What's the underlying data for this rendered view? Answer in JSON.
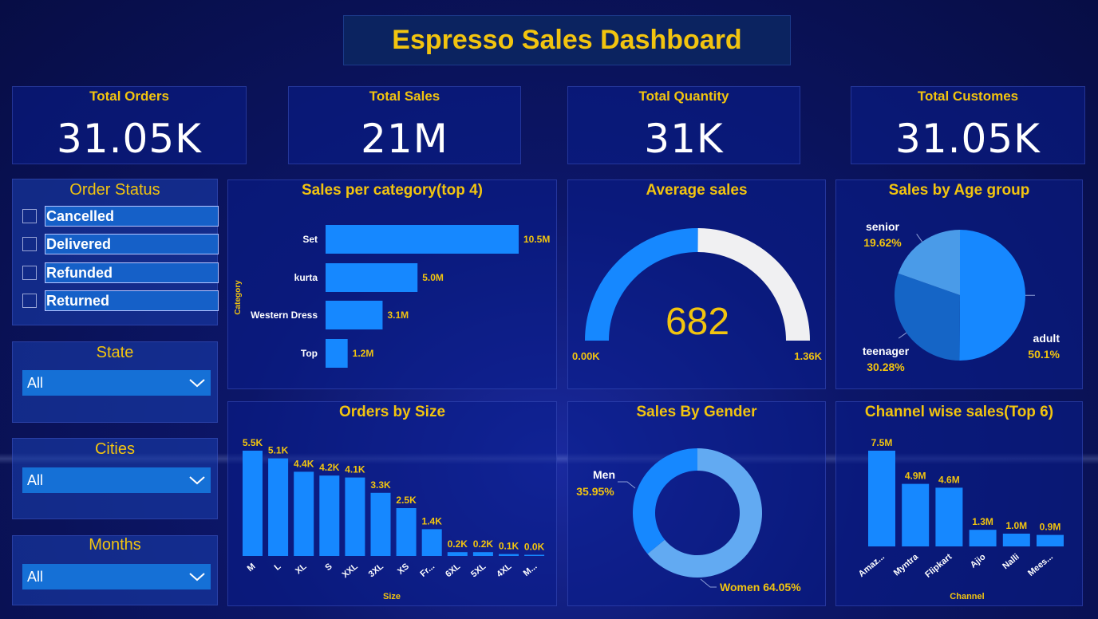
{
  "title": "Espresso Sales Dashboard",
  "kpis": [
    {
      "label": "Total Orders",
      "value": "31.05K"
    },
    {
      "label": "Total Sales",
      "value": "21M"
    },
    {
      "label": "Total Quantity",
      "value": "31K"
    },
    {
      "label": "Total Customes",
      "value": "31.05K"
    }
  ],
  "filters": {
    "order_status": {
      "title": "Order Status",
      "options": [
        "Cancelled",
        "Delivered",
        "Refunded",
        "Returned"
      ]
    },
    "state": {
      "title": "State",
      "value": "All"
    },
    "cities": {
      "title": "Cities",
      "value": "All"
    },
    "months": {
      "title": "Months",
      "value": "All"
    }
  },
  "chart_data": [
    {
      "type": "bar",
      "orientation": "horizontal",
      "title": "Sales per category(top 4)",
      "ylabel": "Category",
      "categories": [
        "Set",
        "kurta",
        "Western Dress",
        "Top"
      ],
      "values": [
        10.5,
        5.0,
        3.1,
        1.2
      ],
      "labels": [
        "10.5M",
        "5.0M",
        "3.1M",
        "1.2M"
      ],
      "color": "#1688ff"
    },
    {
      "type": "gauge",
      "title": "Average sales",
      "value": 682,
      "value_label": "682",
      "min": 0,
      "max": 1360,
      "min_label": "0.00K",
      "max_label": "1.36K",
      "colors": {
        "fill": "#1688ff",
        "rest": "#f0f0f2",
        "value": "#f2c40f"
      }
    },
    {
      "type": "pie",
      "title": "Sales by Age group",
      "slices": [
        {
          "name": "adult",
          "value": 50.1,
          "label": "50.1%",
          "color": "#1688ff"
        },
        {
          "name": "teenager",
          "value": 30.28,
          "label": "30.28%",
          "color": "#1565c6"
        },
        {
          "name": "senior",
          "value": 19.62,
          "label": "19.62%",
          "color": "#4a9be8"
        }
      ]
    },
    {
      "type": "bar",
      "title": "Orders by Size",
      "xlabel": "Size",
      "categories": [
        "M",
        "L",
        "XL",
        "S",
        "XXL",
        "3XL",
        "XS",
        "Fr...",
        "6XL",
        "5XL",
        "4XL",
        "M..."
      ],
      "values": [
        5.5,
        5.1,
        4.4,
        4.2,
        4.1,
        3.3,
        2.5,
        1.4,
        0.2,
        0.2,
        0.1,
        0.0
      ],
      "labels": [
        "5.5K",
        "5.1K",
        "4.4K",
        "4.2K",
        "4.1K",
        "3.3K",
        "2.5K",
        "1.4K",
        "0.2K",
        "0.2K",
        "0.1K",
        "0.0K"
      ],
      "color": "#1688ff"
    },
    {
      "type": "donut",
      "title": "Sales By Gender",
      "slices": [
        {
          "name": "Women",
          "value": 64.05,
          "label": "64.05%",
          "color": "#62aaf2"
        },
        {
          "name": "Men",
          "value": 35.95,
          "label": "35.95%",
          "color": "#1688ff"
        }
      ]
    },
    {
      "type": "bar",
      "title": "Channel wise sales(Top 6)",
      "xlabel": "Channel",
      "categories": [
        "Amaz...",
        "Myntra",
        "Flipkart",
        "Ajio",
        "Nalli",
        "Mees..."
      ],
      "values": [
        7.5,
        4.9,
        4.6,
        1.3,
        1.0,
        0.9
      ],
      "labels": [
        "7.5M",
        "4.9M",
        "4.6M",
        "1.3M",
        "1.0M",
        "0.9M"
      ],
      "color": "#1688ff"
    }
  ]
}
